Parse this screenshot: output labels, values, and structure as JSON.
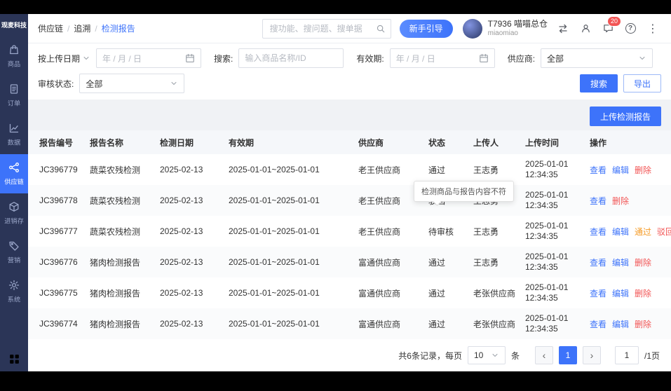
{
  "colors": {
    "accent": "#3d73fa",
    "sidebar_bg": "#2b3557",
    "danger": "#f25555",
    "warning": "#f59a23",
    "page_bg": "#f0f2f5"
  },
  "sidebar": {
    "logo": "观麦科技",
    "items": [
      {
        "key": "goods",
        "label": "商品",
        "icon": "goods-icon",
        "active": false
      },
      {
        "key": "orders",
        "label": "订单",
        "icon": "order-icon",
        "active": false
      },
      {
        "key": "data",
        "label": "数据",
        "icon": "data-icon",
        "active": false
      },
      {
        "key": "supply-chain",
        "label": "供应链",
        "icon": "supply-chain-icon",
        "active": true
      },
      {
        "key": "inventory",
        "label": "进销存",
        "icon": "inventory-icon",
        "active": false
      },
      {
        "key": "marketing",
        "label": "营销",
        "icon": "marketing-icon",
        "active": false
      },
      {
        "key": "system",
        "label": "系统",
        "icon": "system-icon",
        "active": false
      }
    ]
  },
  "header": {
    "breadcrumb": [
      {
        "label": "供应链",
        "current": false
      },
      {
        "label": "追溯",
        "current": false
      },
      {
        "label": "检测报告",
        "current": true
      }
    ],
    "search_placeholder": "搜功能、搜问题、搜单据",
    "guide_button": "新手引导",
    "account_line1": "T7936 喵喵总仓",
    "account_line2": "miaomiao",
    "message_badge": "20"
  },
  "filters": {
    "date_type_label": "按上传日期",
    "upload_date_placeholder": "年 / 月 / 日",
    "search_label": "搜索:",
    "search_placeholder": "输入商品名称/ID",
    "validity_label": "有效期:",
    "validity_placeholder": "年 / 月 / 日",
    "supplier_label": "供应商:",
    "supplier_value": "全部",
    "status_label": "审核状态:",
    "status_value": "全部",
    "search_button": "搜索",
    "export_button": "导出"
  },
  "toolbar": {
    "upload_button": "上传检测报告"
  },
  "table": {
    "columns": [
      "报告编号",
      "报告名称",
      "检测日期",
      "有效期",
      "供应商",
      "状态",
      "上传人",
      "上传时间",
      "操作"
    ],
    "rows": [
      {
        "report_no": "JC396779",
        "report_name": "蔬菜农残检测",
        "test_date": "2025-02-13",
        "validity": "2025-01-01~2025-01-01",
        "supplier": "老王供应商",
        "status": "通过",
        "uploader": "王志勇",
        "upload_date": "2025-01-01",
        "upload_time": "12:34:35",
        "actions": [
          {
            "key": "view",
            "label": "查看",
            "color": "blue"
          },
          {
            "key": "edit",
            "label": "编辑",
            "color": "blue"
          },
          {
            "key": "delete",
            "label": "删除",
            "color": "red"
          }
        ]
      },
      {
        "report_no": "JC396778",
        "report_name": "蔬菜农残检测",
        "test_date": "2025-02-13",
        "validity": "2025-01-01~2025-01-01",
        "supplier": "老王供应商",
        "status": "驳回",
        "uploader": "王志勇",
        "upload_date": "2025-01-01",
        "upload_time": "12:34:35",
        "actions": [
          {
            "key": "view",
            "label": "查看",
            "color": "blue"
          },
          {
            "key": "delete",
            "label": "删除",
            "color": "red"
          }
        ]
      },
      {
        "report_no": "JC396777",
        "report_name": "蔬菜农残检测",
        "test_date": "2025-02-13",
        "validity": "2025-01-01~2025-01-01",
        "supplier": "老王供应商",
        "status": "待审核",
        "uploader": "王志勇",
        "upload_date": "2025-01-01",
        "upload_time": "12:34:35",
        "actions": [
          {
            "key": "view",
            "label": "查看",
            "color": "blue"
          },
          {
            "key": "edit",
            "label": "编辑",
            "color": "blue"
          },
          {
            "key": "approve",
            "label": "通过",
            "color": "orange"
          },
          {
            "key": "reject",
            "label": "驳回",
            "color": "red"
          }
        ]
      },
      {
        "report_no": "JC396776",
        "report_name": "猪肉检测报告",
        "test_date": "2025-02-13",
        "validity": "2025-01-01~2025-01-01",
        "supplier": "富通供应商",
        "status": "通过",
        "uploader": "王志勇",
        "upload_date": "2025-01-01",
        "upload_time": "12:34:35",
        "actions": [
          {
            "key": "view",
            "label": "查看",
            "color": "blue"
          },
          {
            "key": "edit",
            "label": "编辑",
            "color": "blue"
          },
          {
            "key": "delete",
            "label": "删除",
            "color": "red"
          }
        ]
      },
      {
        "report_no": "JC396775",
        "report_name": "猪肉检测报告",
        "test_date": "2025-02-13",
        "validity": "2025-01-01~2025-01-01",
        "supplier": "富通供应商",
        "status": "通过",
        "uploader": "老张供应商",
        "upload_date": "2025-01-01",
        "upload_time": "12:34:35",
        "actions": [
          {
            "key": "view",
            "label": "查看",
            "color": "blue"
          },
          {
            "key": "edit",
            "label": "编辑",
            "color": "blue"
          },
          {
            "key": "delete",
            "label": "删除",
            "color": "red"
          }
        ]
      },
      {
        "report_no": "JC396774",
        "report_name": "猪肉检测报告",
        "test_date": "2025-02-13",
        "validity": "2025-01-01~2025-01-01",
        "supplier": "富通供应商",
        "status": "通过",
        "uploader": "老张供应商",
        "upload_date": "2025-01-01",
        "upload_time": "12:34:35",
        "actions": [
          {
            "key": "view",
            "label": "查看",
            "color": "blue"
          },
          {
            "key": "edit",
            "label": "编辑",
            "color": "blue"
          },
          {
            "key": "delete",
            "label": "删除",
            "color": "red"
          }
        ]
      }
    ]
  },
  "tooltip": {
    "text": "检测商品与报告内容不符"
  },
  "pagination": {
    "summary": "共6条记录，每页",
    "page_size": "10",
    "unit": "条",
    "prev": "‹",
    "current_page": "1",
    "next": "›",
    "jump_value": "1",
    "pages_suffix": "/1页"
  }
}
